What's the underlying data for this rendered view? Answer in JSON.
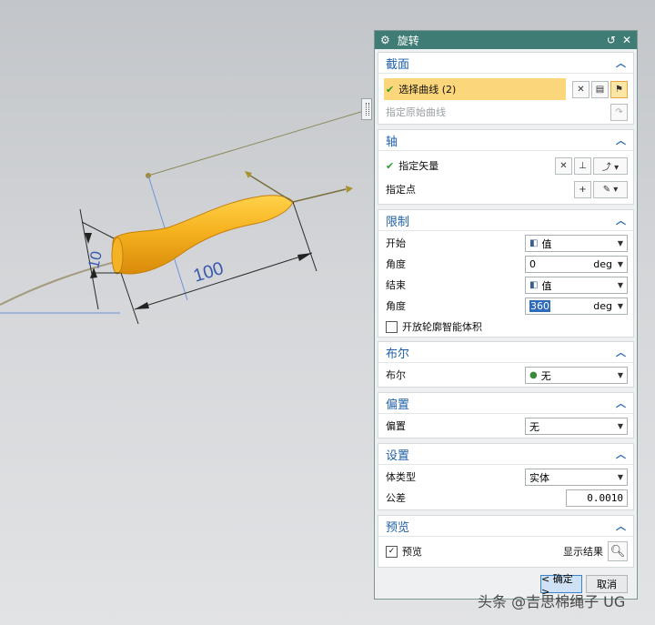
{
  "dialog": {
    "title": "旋转",
    "title_reset": "↺",
    "title_close": "✕",
    "section": {
      "header": "截面",
      "select_curve": "选择曲线 (2)",
      "specify_original": "指定原始曲线"
    },
    "axis": {
      "header": "轴",
      "specify_vector": "指定矢量",
      "specify_point": "指定点"
    },
    "limits": {
      "header": "限制",
      "start_label": "开始",
      "start_value": "值",
      "angle_label": "角度",
      "start_angle": "0",
      "end_label": "结束",
      "end_value": "值",
      "end_angle": "360",
      "unit": "deg",
      "open_profile": "开放轮廓智能体积"
    },
    "boolean": {
      "header": "布尔",
      "label": "布尔",
      "value": "无"
    },
    "offset": {
      "header": "偏置",
      "label": "偏置",
      "value": "无"
    },
    "settings": {
      "header": "设置",
      "body_type_label": "体类型",
      "body_type": "实体",
      "tolerance_label": "公差",
      "tolerance": "0.0010"
    },
    "preview": {
      "header": "预览",
      "preview_label": "预览",
      "show_result": "显示结果"
    },
    "ok": "< 确定 >",
    "cancel": "取消"
  },
  "viewport": {
    "dim_small": "10",
    "dim_large": "100"
  },
  "watermark": "头条 @吉思棉绳子 UG",
  "colors": {
    "titlebar": "#3f7c75",
    "section_header": "#1e60a5",
    "highlight": "#fcd67a",
    "solid_body": "#f2a71b"
  }
}
